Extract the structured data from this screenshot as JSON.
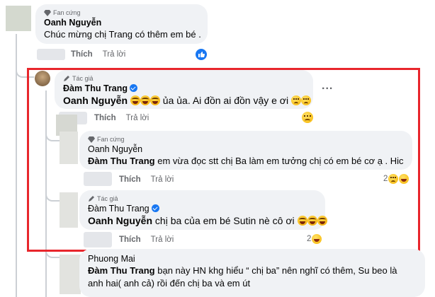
{
  "comments": {
    "c1": {
      "badge": "Fan cứng",
      "badge_icon": "diamond-icon",
      "name": "Oanh Nguyễn",
      "text": "Chúc mừng chị Trang có thêm em bé .",
      "like_label": "Thích",
      "reply_label": "Trả lời"
    },
    "c2": {
      "badge": "Tác giả",
      "badge_icon": "pencil-icon",
      "name": "Đàm Thu Trang",
      "mention": "Oanh Nguyễn",
      "text": "ủa ủa. Ai đồn ai đồn vậy e ơi",
      "like_label": "Thích",
      "reply_label": "Trả lời",
      "more_label": "..."
    },
    "c3": {
      "badge": "Fan cứng",
      "badge_icon": "diamond-icon",
      "name": "Oanh Nguyễn",
      "mention": "Đàm Thu Trang",
      "text": "em vừa đọc stt chị Ba làm em tưởng chị có em bé cơ ạ . Hic",
      "like_label": "Thích",
      "reply_label": "Trả lời",
      "reaction_count": "2"
    },
    "c4": {
      "badge": "Tác giả",
      "badge_icon": "pencil-icon",
      "name": "Đàm Thu Trang",
      "mention": "Oanh Nguyễn",
      "text": "chị ba của em bé Sutin nè cô ơi",
      "like_label": "Thích",
      "reply_label": "Trả lời",
      "reaction_count": "2"
    },
    "c5": {
      "name": "Phuong Mai",
      "mention": "Đàm Thu Trang",
      "text_line1": "bạn này HN khg hiểu “ chị ba” nên nghĩ có thêm, Su beo là",
      "text_line2": "anh hai( anh cả) rồi đến chị ba và em út"
    }
  },
  "colors": {
    "highlight": "#e8262c",
    "accent": "#1877f2",
    "bubble": "#f0f2f5"
  }
}
